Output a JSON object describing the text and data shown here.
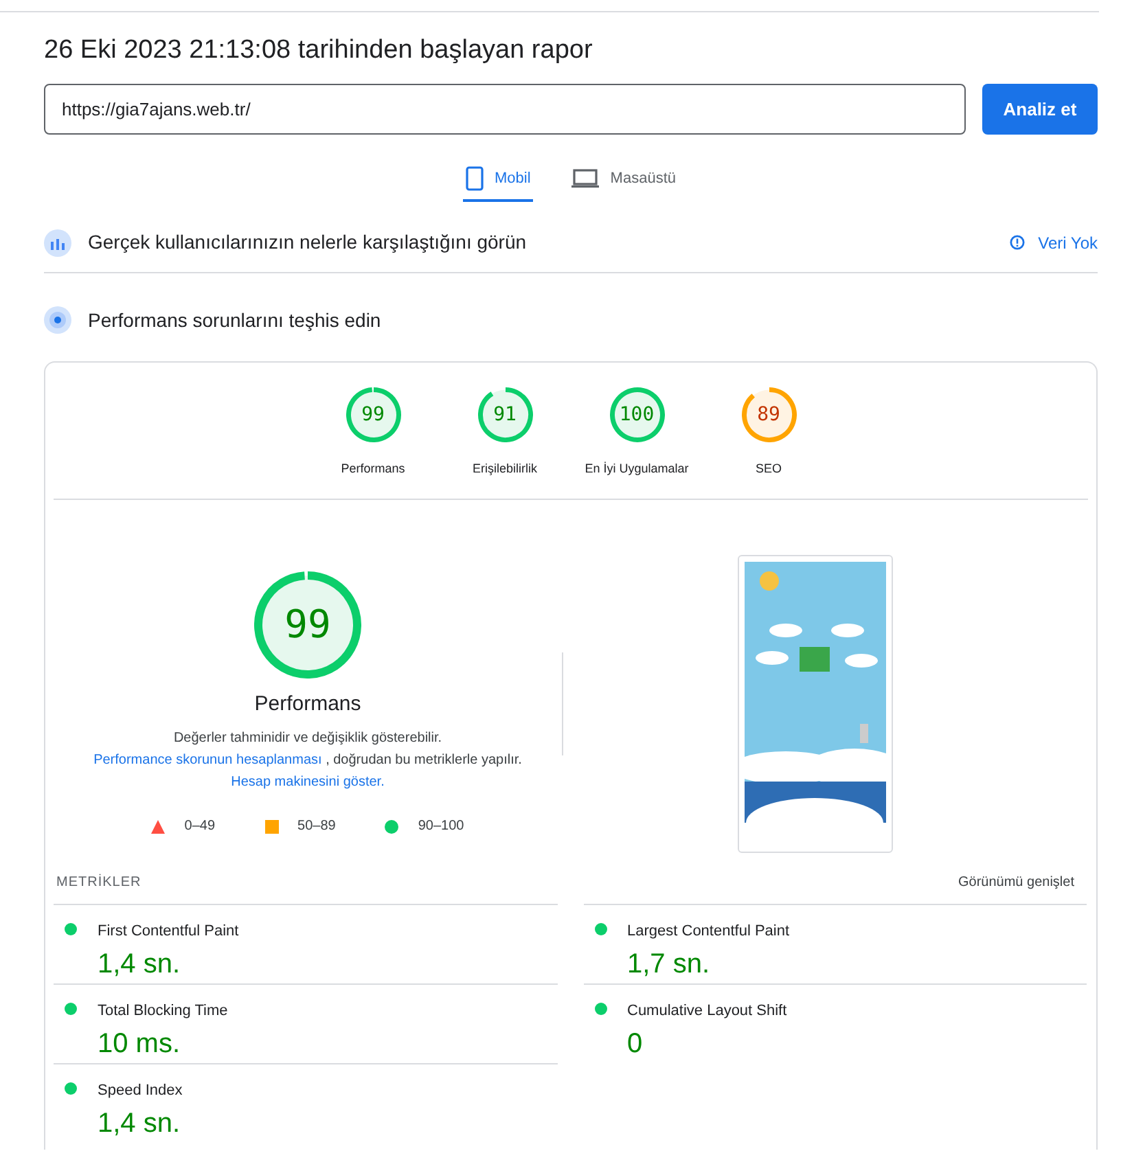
{
  "report_title": "26 Eki 2023 21:13:08 tarihinden başlayan rapor",
  "url_field": {
    "value": "https://gia7ajans.web.tr/"
  },
  "analyze_button": "Analiz et",
  "tabs": [
    {
      "label": "Mobil",
      "kind": "phone",
      "selected": true
    },
    {
      "label": "Masaüstü",
      "kind": "laptop",
      "selected": false
    }
  ],
  "field_data": {
    "title": "Gerçek kullanıcılarınızın nelerle karşılaştığını görün",
    "status": "Veri Yok"
  },
  "lab_data": {
    "title": "Performans sorunlarını teşhis edin"
  },
  "categories": [
    {
      "score": "99",
      "level": 0.99,
      "label": "Performans"
    },
    {
      "score": "91",
      "level": 0.91,
      "label": "Erişilebilirlik"
    },
    {
      "score": "100",
      "level": 1.0,
      "label": "En İyi Uygulamalar"
    },
    {
      "score": "89",
      "level": 0.89,
      "label": "SEO"
    }
  ],
  "main_gauge": {
    "score": "99",
    "level": 0.99,
    "label": "Performans"
  },
  "description": [
    {
      "kind": "text",
      "text": "Değerler tahminidir ve değişiklik gösterebilir."
    },
    {
      "kind": "link",
      "text": "Performance skorunun hesaplanması"
    },
    {
      "kind": "text",
      "text": ", doğrudan bu metriklerle yapılır."
    },
    {
      "kind": "link",
      "text": "Hesap makinesini göster."
    }
  ],
  "legend": [
    {
      "kind": "fail",
      "label": "0–49"
    },
    {
      "kind": "average",
      "label": "50–89"
    },
    {
      "kind": "pass",
      "label": "90–100"
    }
  ],
  "metrics": {
    "heading": "METRİKLER",
    "expand": "Görünümü genişlet",
    "items": [
      {
        "name": "First Contentful Paint",
        "value": "1,4 sn.",
        "color": "#0cce6b"
      },
      {
        "name": "Largest Contentful Paint",
        "value": "1,7 sn.",
        "color": "#0cce6b"
      },
      {
        "name": "Total Blocking Time",
        "value": "10 ms.",
        "color": "#0cce6b"
      },
      {
        "name": "Cumulative Layout Shift",
        "value": "0",
        "color": "#0cce6b"
      },
      {
        "name": "Speed Index",
        "value": "1,4 sn.",
        "color": "#0cce6b"
      }
    ]
  }
}
